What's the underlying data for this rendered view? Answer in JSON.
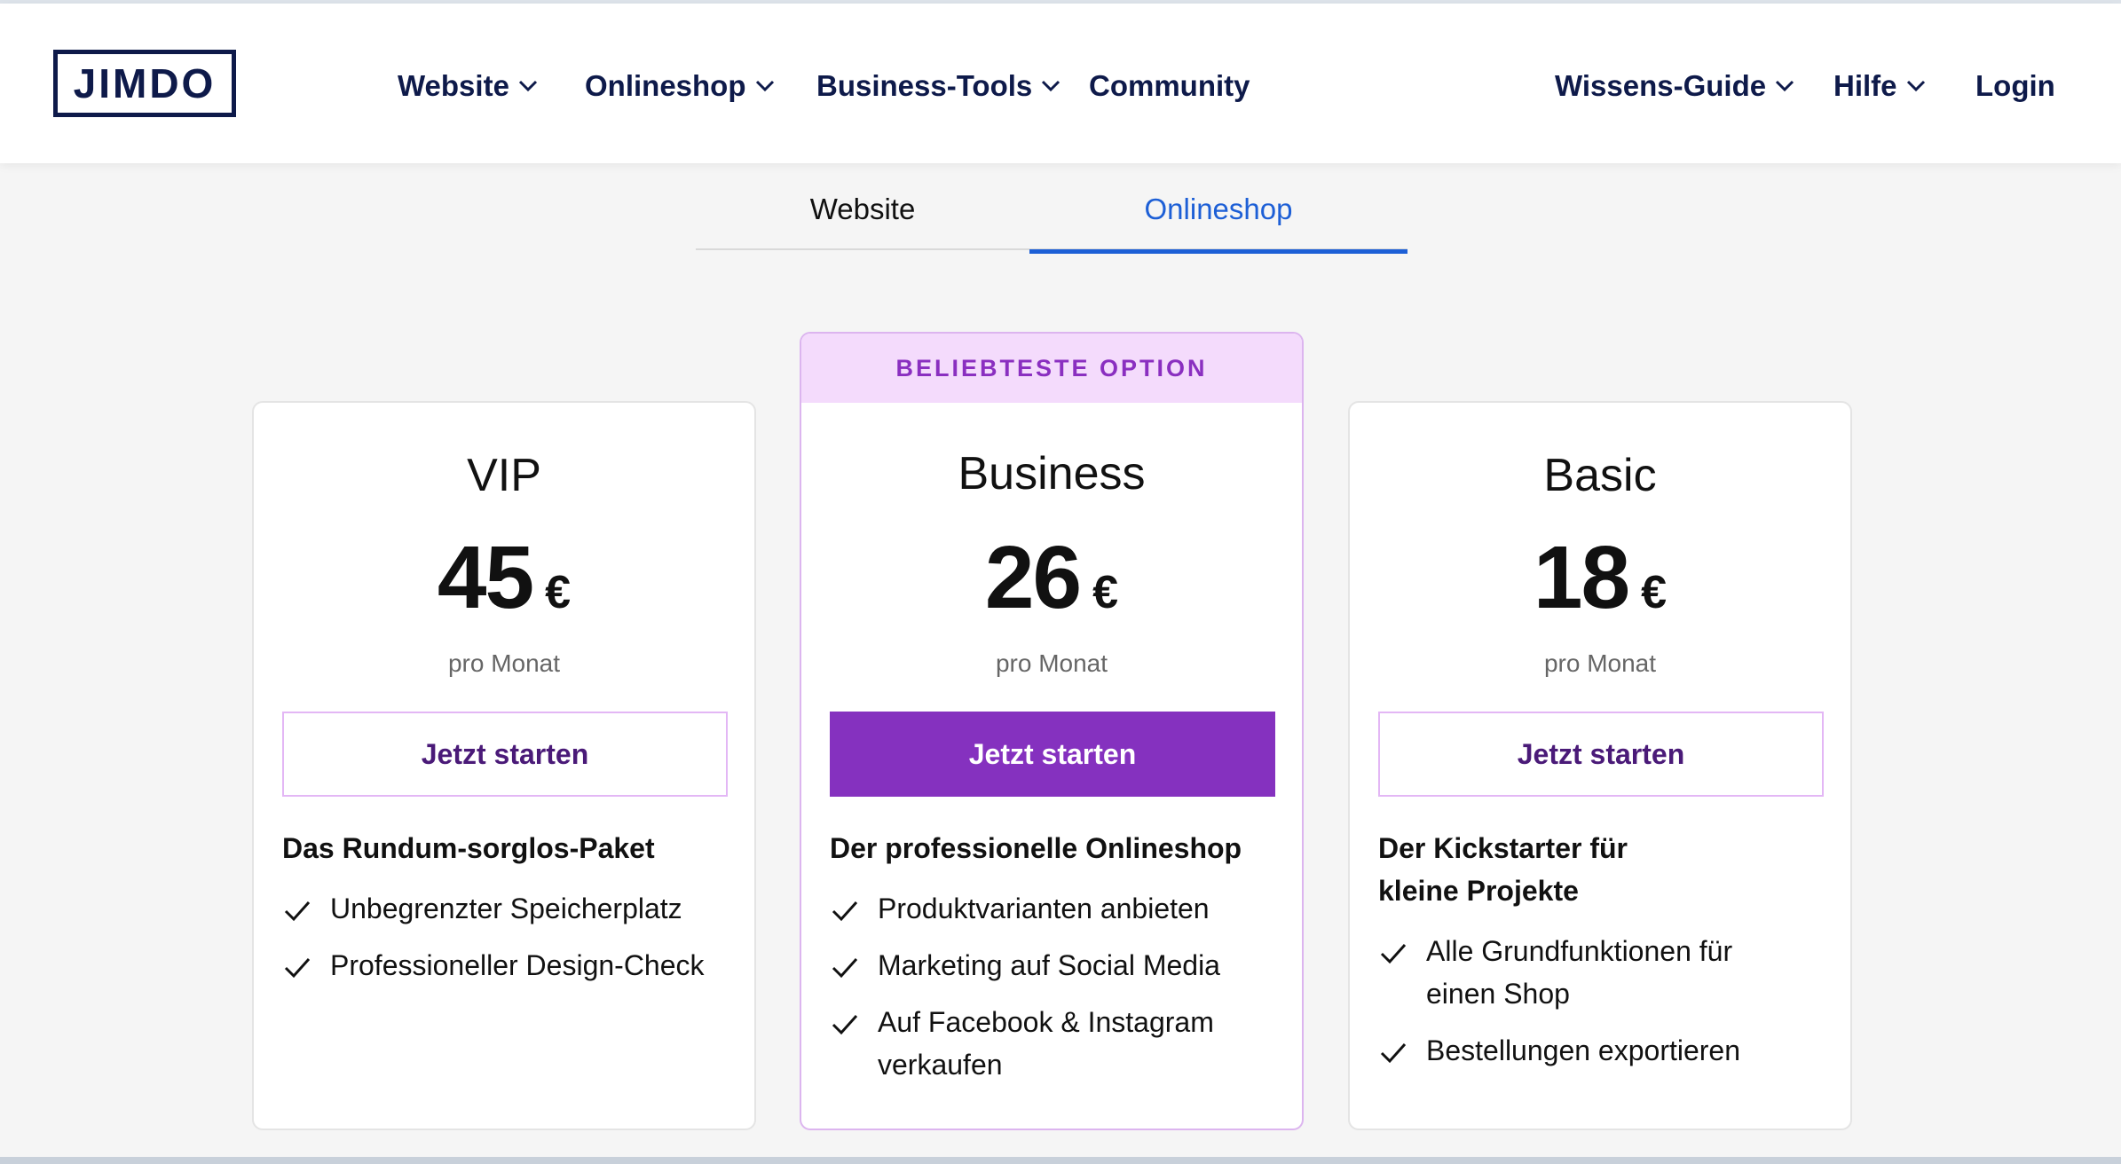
{
  "brand": {
    "logo_text": "JIMDO"
  },
  "nav": {
    "left": [
      {
        "label": "Website",
        "has_dropdown": true
      },
      {
        "label": "Onlineshop",
        "has_dropdown": true
      },
      {
        "label": "Business-Tools",
        "has_dropdown": true
      },
      {
        "label": "Community",
        "has_dropdown": false
      }
    ],
    "right": [
      {
        "label": "Wissens-Guide",
        "has_dropdown": true
      },
      {
        "label": "Hilfe",
        "has_dropdown": true
      },
      {
        "label": "Login",
        "has_dropdown": false
      }
    ]
  },
  "tabs": [
    {
      "label": "Website",
      "active": false
    },
    {
      "label": "Onlineshop",
      "active": true
    }
  ],
  "plans": [
    {
      "name": "VIP",
      "price": "45",
      "currency": "€",
      "period": "pro Monat",
      "cta": "Jetzt starten",
      "tagline": "Das Rundum-sorglos-Paket",
      "features": [
        "Unbegrenzter Speicherplatz",
        "Professioneller Design-Check"
      ]
    },
    {
      "name": "Business",
      "badge": "BELIEBTESTE OPTION",
      "price": "26",
      "currency": "€",
      "period": "pro Monat",
      "cta": "Jetzt starten",
      "tagline": "Der professionelle Onlineshop",
      "features": [
        "Produktvarianten anbieten",
        "Marketing auf Social Media",
        "Auf Facebook & Instagram verkaufen"
      ]
    },
    {
      "name": "Basic",
      "price": "18",
      "currency": "€",
      "period": "pro Monat",
      "cta": "Jetzt starten",
      "tagline": "Der Kickstarter für kleine Projekte",
      "features": [
        "Alle Grundfunktionen für einen Shop",
        "Bestellungen exportieren"
      ]
    }
  ],
  "colors": {
    "navy": "#0e1a4a",
    "tab_active": "#1d5fd6",
    "purple": "#8531bf",
    "badge_bg": "#f4dbfc",
    "badge_text": "#8a2fc0"
  },
  "icons": {
    "dropdown": "chevron-down-icon",
    "feature": "check-icon"
  }
}
